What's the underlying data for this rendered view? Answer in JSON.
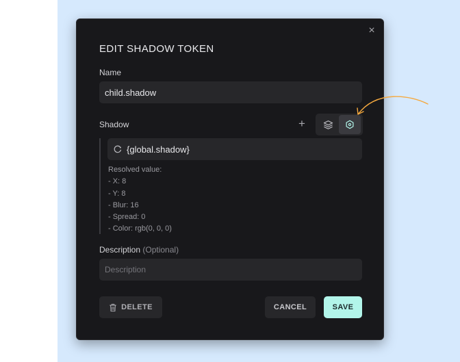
{
  "modal": {
    "title": "EDIT SHADOW TOKEN",
    "close_glyph": "×"
  },
  "name_field": {
    "label": "Name",
    "value": "child.shadow"
  },
  "shadow_field": {
    "label": "Shadow",
    "add_glyph": "+",
    "reference_value": "{global.shadow}",
    "resolved": {
      "heading": "Resolved value:",
      "lines": [
        "- X: 8",
        "- Y: 8",
        "- Blur: 16",
        "- Spread: 0",
        "- Color: rgb(0, 0, 0)"
      ]
    },
    "modes": [
      {
        "icon": "layers-icon",
        "active": false
      },
      {
        "icon": "hexagon-token-icon",
        "active": true
      }
    ]
  },
  "description_field": {
    "label": "Description",
    "optional": "(Optional)",
    "placeholder": "Description"
  },
  "buttons": {
    "delete": "DELETE",
    "cancel": "CANCEL",
    "save": "SAVE"
  },
  "colors": {
    "modal_bg": "#18181b",
    "input_bg": "#27272a",
    "accent": "#b2f5ea",
    "arrow": "#f5a93f",
    "backdrop": "#d6e9fd"
  }
}
